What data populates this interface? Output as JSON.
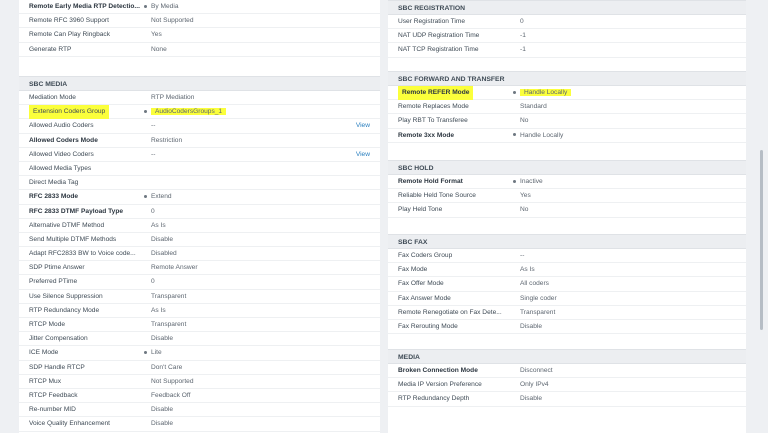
{
  "left": {
    "top_rows": [
      {
        "label": "Remote Early Media RTP Detectio...",
        "value": "By Media",
        "bold": true,
        "dot": true
      },
      {
        "label": "Remote RFC 3960 Support",
        "value": "Not Supported",
        "bold": false,
        "dot": false
      },
      {
        "label": "Remote Can Play Ringback",
        "value": "Yes",
        "bold": false,
        "dot": false
      },
      {
        "label": "Generate RTP",
        "value": "None",
        "bold": false,
        "dot": false
      }
    ],
    "media": {
      "title": "SBC MEDIA",
      "rows": [
        {
          "label": "Mediation Mode",
          "value": "RTP Mediation",
          "bold": false,
          "dot": false
        },
        {
          "label": "Extension Coders Group",
          "value": "AudioCodersGroups_1",
          "bold": false,
          "dot": true,
          "highlight": true
        },
        {
          "label": "Allowed Audio Coders",
          "value": "--",
          "bold": false,
          "dot": false,
          "link": "View"
        },
        {
          "label": "Allowed Coders Mode",
          "value": "Restriction",
          "bold": true,
          "dot": false
        },
        {
          "label": "Allowed Video Coders",
          "value": "--",
          "bold": false,
          "dot": false,
          "link": "View"
        },
        {
          "label": "Allowed Media Types",
          "value": "",
          "bold": false,
          "dot": false
        },
        {
          "label": "Direct Media Tag",
          "value": "",
          "bold": false,
          "dot": false
        },
        {
          "label": "RFC 2833 Mode",
          "value": "Extend",
          "bold": true,
          "dot": true
        },
        {
          "label": "RFC 2833 DTMF Payload Type",
          "value": "0",
          "bold": true,
          "dot": false
        },
        {
          "label": "Alternative DTMF Method",
          "value": "As Is",
          "bold": false,
          "dot": false
        },
        {
          "label": "Send Multiple DTMF Methods",
          "value": "Disable",
          "bold": false,
          "dot": false
        },
        {
          "label": "Adapt RFC2833 BW to Voice code...",
          "value": "Disabled",
          "bold": false,
          "dot": false
        },
        {
          "label": "SDP Ptime Answer",
          "value": "Remote Answer",
          "bold": false,
          "dot": false
        },
        {
          "label": "Preferred PTime",
          "value": "0",
          "bold": false,
          "dot": false
        },
        {
          "label": "Use Silence Suppression",
          "value": "Transparent",
          "bold": false,
          "dot": false
        },
        {
          "label": "RTP Redundancy Mode",
          "value": "As Is",
          "bold": false,
          "dot": false
        },
        {
          "label": "RTCP Mode",
          "value": "Transparent",
          "bold": false,
          "dot": false
        },
        {
          "label": "Jitter Compensation",
          "value": "Disable",
          "bold": false,
          "dot": false
        },
        {
          "label": "ICE Mode",
          "value": "Lite",
          "bold": false,
          "dot": true
        },
        {
          "label": "SDP Handle RTCP",
          "value": "Don't Care",
          "bold": false,
          "dot": false
        },
        {
          "label": "RTCP Mux",
          "value": "Not Supported",
          "bold": false,
          "dot": false
        },
        {
          "label": "RTCP Feedback",
          "value": "Feedback Off",
          "bold": false,
          "dot": false
        },
        {
          "label": "Re-number MID",
          "value": "Disable",
          "bold": false,
          "dot": false
        },
        {
          "label": "Voice Quality Enhancement",
          "value": "Disable",
          "bold": false,
          "dot": false
        }
      ]
    }
  },
  "right": {
    "registration": {
      "title": "SBC REGISTRATION",
      "rows": [
        {
          "label": "User Registration Time",
          "value": "0",
          "bold": false,
          "dot": false
        },
        {
          "label": "NAT UDP Registration Time",
          "value": "-1",
          "bold": false,
          "dot": false
        },
        {
          "label": "NAT TCP Registration Time",
          "value": "-1",
          "bold": false,
          "dot": false
        }
      ]
    },
    "forward": {
      "title": "SBC FORWARD AND TRANSFER",
      "rows": [
        {
          "label": "Remote REFER Mode",
          "value": "Handle Locally",
          "bold": true,
          "dot": true,
          "highlight": true
        },
        {
          "label": "Remote Replaces Mode",
          "value": "Standard",
          "bold": false,
          "dot": false
        },
        {
          "label": "Play RBT To Transferee",
          "value": "No",
          "bold": false,
          "dot": false
        },
        {
          "label": "Remote 3xx Mode",
          "value": "Handle Locally",
          "bold": true,
          "dot": true
        }
      ]
    },
    "hold": {
      "title": "SBC HOLD",
      "rows": [
        {
          "label": "Remote Hold Format",
          "value": "Inactive",
          "bold": true,
          "dot": true
        },
        {
          "label": "Reliable Held Tone Source",
          "value": "Yes",
          "bold": false,
          "dot": false
        },
        {
          "label": "Play Held Tone",
          "value": "No",
          "bold": false,
          "dot": false
        }
      ]
    },
    "fax": {
      "title": "SBC FAX",
      "rows": [
        {
          "label": "Fax Coders Group",
          "value": "--",
          "bold": false,
          "dot": false
        },
        {
          "label": "Fax Mode",
          "value": "As Is",
          "bold": false,
          "dot": false
        },
        {
          "label": "Fax Offer Mode",
          "value": "All coders",
          "bold": false,
          "dot": false
        },
        {
          "label": "Fax Answer Mode",
          "value": "Single coder",
          "bold": false,
          "dot": false
        },
        {
          "label": "Remote Renegotiate on Fax Dete...",
          "value": "Transparent",
          "bold": false,
          "dot": false
        },
        {
          "label": "Fax Rerouting Mode",
          "value": "Disable",
          "bold": false,
          "dot": false
        }
      ]
    },
    "media": {
      "title": "MEDIA",
      "rows": [
        {
          "label": "Broken Connection Mode",
          "value": "Disconnect",
          "bold": true,
          "dot": false
        },
        {
          "label": "Media IP Version Preference",
          "value": "Only IPv4",
          "bold": false,
          "dot": false
        },
        {
          "label": "RTP Redundancy Depth",
          "value": "Disable",
          "bold": false,
          "dot": false
        }
      ]
    }
  }
}
